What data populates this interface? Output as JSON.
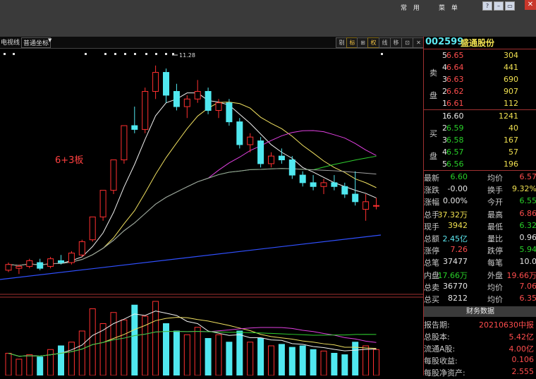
{
  "window": {
    "menu_left": "常 用",
    "menu_right": "菜 单",
    "buttons": [
      "?",
      "–",
      "▭",
      "✕"
    ]
  },
  "toolbar": {
    "left_label": "电视线",
    "coord_label": "普通坐标",
    "dropdown_arrow": "▼",
    "buttons": [
      "剔",
      "标",
      "⊞",
      "权",
      "线",
      "移",
      "⊡",
      "✕"
    ]
  },
  "chart": {
    "annotation_text": "6+3板",
    "high_label": "11.28"
  },
  "stock": {
    "code": "002599",
    "name": "盛通股份"
  },
  "order_book": {
    "sell_label": [
      "卖",
      "盘"
    ],
    "buy_label": [
      "买",
      "盘"
    ],
    "sell": [
      {
        "level": "5",
        "price": "6.65",
        "volume": "304"
      },
      {
        "level": "4",
        "price": "6.64",
        "volume": "441"
      },
      {
        "level": "3",
        "price": "6.63",
        "volume": "690"
      },
      {
        "level": "2",
        "price": "6.62",
        "volume": "907"
      },
      {
        "level": "1",
        "price": "6.61",
        "volume": "112"
      }
    ],
    "buy": [
      {
        "level": "1",
        "price": "6.60",
        "volume": "1241"
      },
      {
        "level": "2",
        "price": "6.59",
        "volume": "40"
      },
      {
        "level": "3",
        "price": "6.58",
        "volume": "167"
      },
      {
        "level": "4",
        "price": "6.57",
        "volume": "57"
      },
      {
        "level": "5",
        "price": "6.56",
        "volume": "196"
      }
    ]
  },
  "quote": [
    {
      "l1": "最新",
      "v1": "6.60",
      "c1": "green",
      "l2": "均价",
      "v2": "6.57",
      "c2": "red"
    },
    {
      "l1": "涨跌",
      "v1": "-0.00",
      "c1": "white",
      "l2": "换手",
      "v2": "9.32%",
      "c2": "yellow"
    },
    {
      "l1": "涨幅",
      "v1": "0.00%",
      "c1": "white",
      "l2": "今开",
      "v2": "6.55",
      "c2": "green"
    },
    {
      "l1": "总手",
      "v1": "37.32万",
      "c1": "yellow",
      "l2": "最高",
      "v2": "6.86",
      "c2": "red"
    },
    {
      "l1": "现手",
      "v1": "3942",
      "c1": "yellow",
      "l2": "最低",
      "v2": "6.32",
      "c2": "green"
    },
    {
      "l1": "总额",
      "v1": "2.45亿",
      "c1": "cyan",
      "l2": "量比",
      "v2": "0.96",
      "c2": "white"
    },
    {
      "l1": "涨停",
      "v1": "7.26",
      "c1": "red",
      "l2": "跌停",
      "v2": "5.94",
      "c2": "green"
    },
    {
      "l1": "总笔",
      "v1": "37477",
      "c1": "white",
      "l2": "每笔",
      "v2": "10.0",
      "c2": "white"
    },
    {
      "l1": "内盘",
      "v1": "17.66万",
      "c1": "green",
      "l2": "外盘",
      "v2": "19.66万",
      "c2": "red"
    },
    {
      "l1": "总卖",
      "v1": "36770",
      "c1": "white",
      "l2": "均价",
      "v2": "7.06",
      "c2": "red"
    },
    {
      "l1": "总买",
      "v1": "8212",
      "c1": "white",
      "l2": "均价",
      "v2": "6.35",
      "c2": "red"
    }
  ],
  "financial": {
    "title": "财务数据",
    "rows": [
      {
        "label": "报告期:",
        "value": "20210630中报"
      },
      {
        "label": "总股本:",
        "value": "5.42亿"
      },
      {
        "label": "流通A股:",
        "value": "4.00亿"
      },
      {
        "label": "每股收益:",
        "value": "0.106"
      },
      {
        "label": "每股净资产:",
        "value": "2.555"
      }
    ]
  },
  "chart_data": {
    "type": "candlestick",
    "title": "",
    "series": [
      {
        "name": "price",
        "ohlc": [
          [
            5.9,
            6.1,
            5.85,
            6.05
          ],
          [
            5.95,
            6.05,
            5.8,
            6.0
          ],
          [
            6.0,
            6.2,
            5.95,
            6.15
          ],
          [
            6.1,
            6.2,
            5.9,
            5.95
          ],
          [
            6.0,
            6.25,
            5.95,
            6.2
          ],
          [
            6.15,
            6.3,
            6.05,
            6.1
          ],
          [
            6.1,
            6.4,
            6.05,
            6.35
          ],
          [
            6.3,
            6.7,
            6.25,
            6.65
          ],
          [
            6.7,
            7.3,
            6.65,
            7.3
          ],
          [
            7.3,
            8.0,
            7.2,
            8.0
          ],
          [
            8.0,
            8.8,
            7.9,
            8.8
          ],
          [
            8.8,
            9.7,
            8.7,
            9.7
          ],
          [
            9.7,
            10.2,
            9.5,
            9.6
          ],
          [
            9.6,
            10.7,
            9.5,
            10.6
          ],
          [
            10.6,
            11.28,
            10.4,
            11.1
          ],
          [
            11.1,
            11.2,
            10.3,
            10.5
          ],
          [
            10.6,
            10.8,
            10.1,
            10.2
          ],
          [
            10.2,
            10.5,
            9.9,
            10.4
          ],
          [
            10.4,
            10.9,
            10.3,
            10.6
          ],
          [
            10.6,
            10.7,
            10.0,
            10.1
          ],
          [
            10.1,
            10.4,
            9.9,
            10.3
          ],
          [
            10.3,
            10.4,
            9.7,
            9.8
          ],
          [
            9.8,
            9.9,
            9.1,
            9.2
          ],
          [
            9.2,
            9.5,
            9.0,
            9.4
          ],
          [
            9.3,
            9.4,
            8.6,
            8.7
          ],
          [
            8.7,
            9.0,
            8.6,
            8.9
          ],
          [
            8.9,
            9.1,
            8.7,
            8.8
          ],
          [
            8.8,
            8.9,
            8.3,
            8.4
          ],
          [
            8.4,
            8.5,
            8.1,
            8.2
          ],
          [
            8.2,
            8.4,
            8.0,
            8.1
          ],
          [
            8.1,
            8.3,
            7.9,
            8.2
          ],
          [
            8.2,
            8.4,
            8.0,
            8.1
          ],
          [
            8.1,
            8.2,
            7.8,
            7.9
          ],
          [
            7.9,
            8.5,
            7.6,
            7.7
          ],
          [
            7.5,
            7.9,
            7.2,
            7.7
          ],
          [
            7.6,
            7.8,
            7.5,
            7.6
          ]
        ]
      }
    ],
    "volume": [
      30,
      22,
      28,
      25,
      35,
      40,
      45,
      60,
      90,
      70,
      85,
      75,
      95,
      80,
      100,
      70,
      60,
      55,
      65,
      50,
      55,
      45,
      60,
      45,
      50,
      40,
      42,
      38,
      40,
      35,
      33,
      30,
      28,
      45,
      40,
      35
    ]
  }
}
